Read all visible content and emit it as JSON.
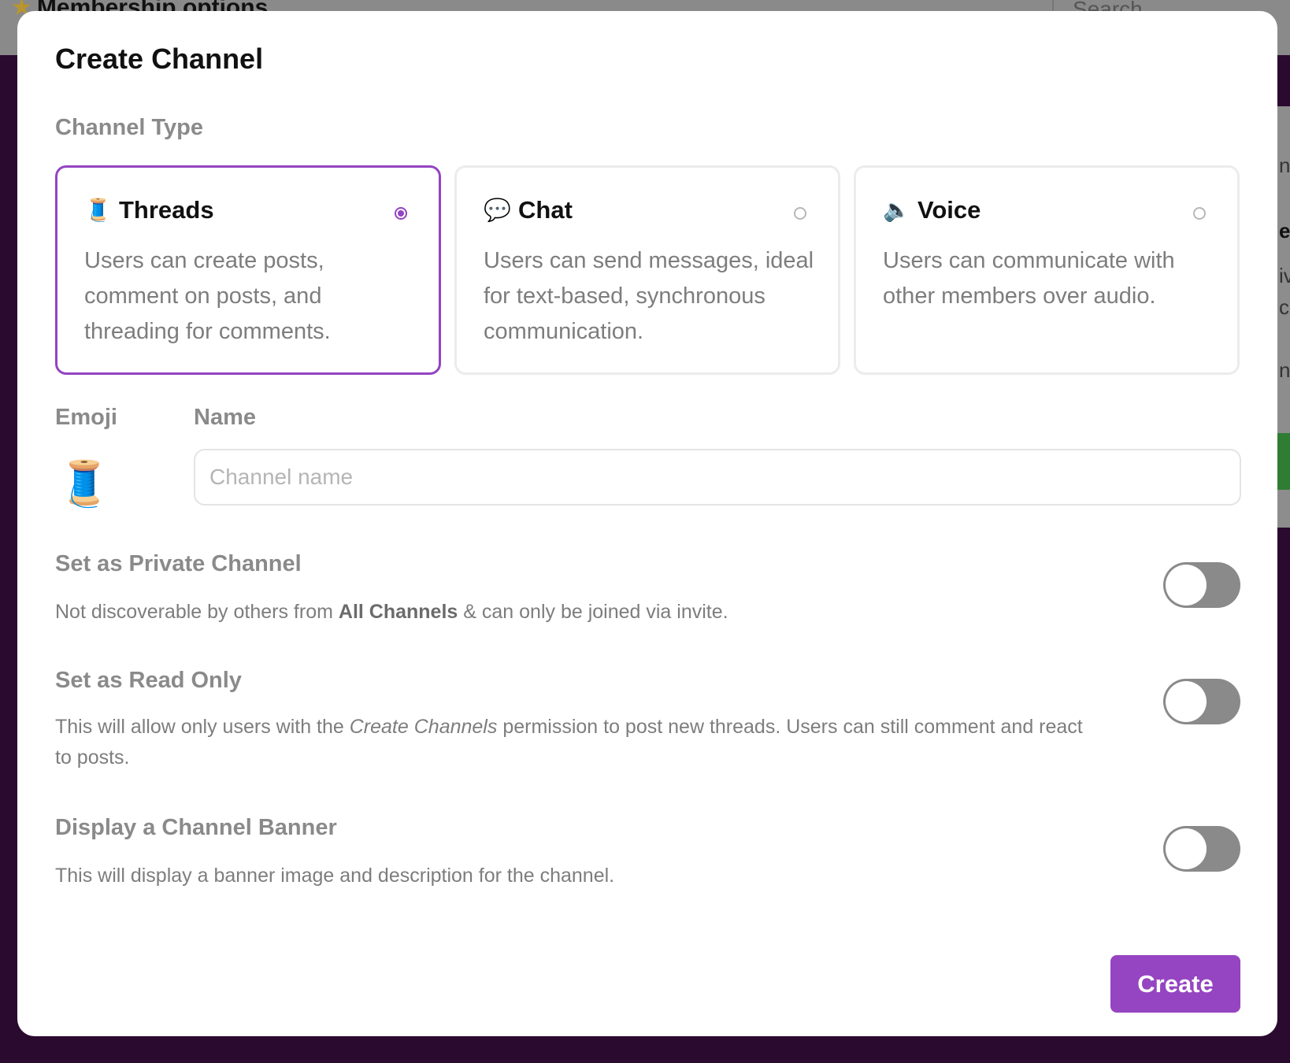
{
  "background": {
    "page_title": "Membership options",
    "search_placeholder": "Search",
    "side_fragments": [
      "n",
      "e",
      "iv",
      "ce",
      "n"
    ]
  },
  "modal": {
    "title": "Create Channel",
    "channel_type_label": "Channel Type",
    "channel_types": [
      {
        "emoji": "🧵",
        "name": "Threads",
        "description": "Users can create posts, comment on posts, and threading for comments.",
        "selected": true
      },
      {
        "emoji": "💬",
        "name": "Chat",
        "description": "Users can send messages, ideal for text-based, synchronous communication.",
        "selected": false
      },
      {
        "emoji": "🔈",
        "name": "Voice",
        "description": "Users can communicate with other members over audio.",
        "selected": false
      }
    ],
    "emoji_label": "Emoji",
    "selected_emoji": "🧵",
    "name_label": "Name",
    "name_placeholder": "Channel name",
    "name_value": "",
    "settings": {
      "private": {
        "title": "Set as Private Channel",
        "desc_before": "Not discoverable by others from ",
        "desc_bold": "All Channels",
        "desc_after": " & can only be joined via invite.",
        "enabled": false
      },
      "read_only": {
        "title": "Set as Read Only",
        "desc_before": "This will allow only users with the ",
        "desc_italic": "Create Channels",
        "desc_after": " permission to post new threads. Users can still comment and react to posts.",
        "enabled": false
      },
      "banner": {
        "title": "Display a Channel Banner",
        "desc": "This will display a banner image and description for the channel.",
        "enabled": false
      }
    },
    "create_label": "Create"
  },
  "colors": {
    "accent": "#9444c1",
    "backdrop": "#2a0a2e",
    "toggle_off": "#8a8a8a"
  }
}
